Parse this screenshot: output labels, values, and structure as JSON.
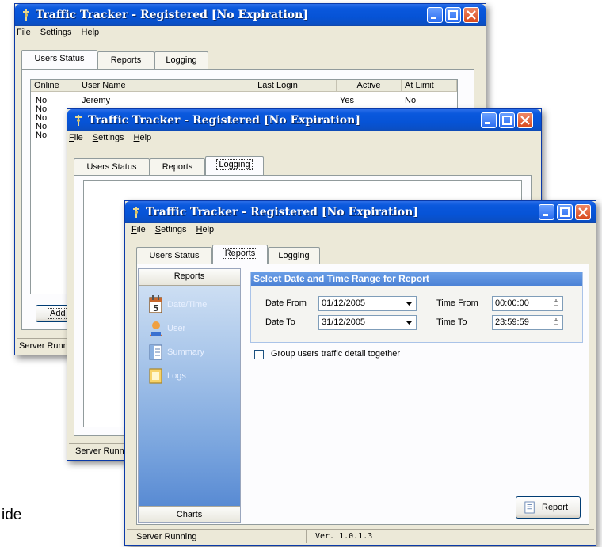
{
  "app": {
    "title": "Traffic Tracker  - Registered  [No Expiration]",
    "menu": [
      "File",
      "Settings",
      "Help"
    ],
    "tabs": [
      "Users Status",
      "Reports",
      "Logging"
    ],
    "status": "Server Running",
    "status_clipped": "Server Runn"
  },
  "users_window": {
    "columns": [
      "Online",
      "User Name",
      "Last Login",
      "Active",
      "At Limit"
    ],
    "rows": [
      {
        "online": "No",
        "user": "Jeremy",
        "active": "Yes",
        "at_limit": "No"
      },
      {
        "online": "No"
      },
      {
        "online": "No"
      },
      {
        "online": "No"
      },
      {
        "online": "No"
      }
    ],
    "add_button_partial": "Add"
  },
  "reports_window": {
    "sidebar_header": "Reports",
    "nav": [
      {
        "label": "Date/Time",
        "icon": "calendar-icon"
      },
      {
        "label": "User",
        "icon": "user-icon"
      },
      {
        "label": "Summary",
        "icon": "summary-icon"
      },
      {
        "label": "Logs",
        "icon": "logs-icon"
      }
    ],
    "sidebar_footer": "Charts",
    "group_title": "Select Date and Time Range for Report",
    "date_from_label": "Date From",
    "date_from": "01/12/2005",
    "date_to_label": "Date To",
    "date_to": "31/12/2005",
    "time_from_label": "Time From",
    "time_from": "00:00:00",
    "time_to_label": "Time To",
    "time_to": "23:59:59",
    "group_checkbox_label": "Group users traffic detail together",
    "report_button": "Report",
    "version": "Ver. 1.0.1.3"
  },
  "background_text": "ide",
  "colors": {
    "title_blue": "#0a58dd",
    "sidebar_top": "#cfe0f4",
    "sidebar_bottom": "#4f83d0",
    "group_header": "#5a8fdc"
  }
}
